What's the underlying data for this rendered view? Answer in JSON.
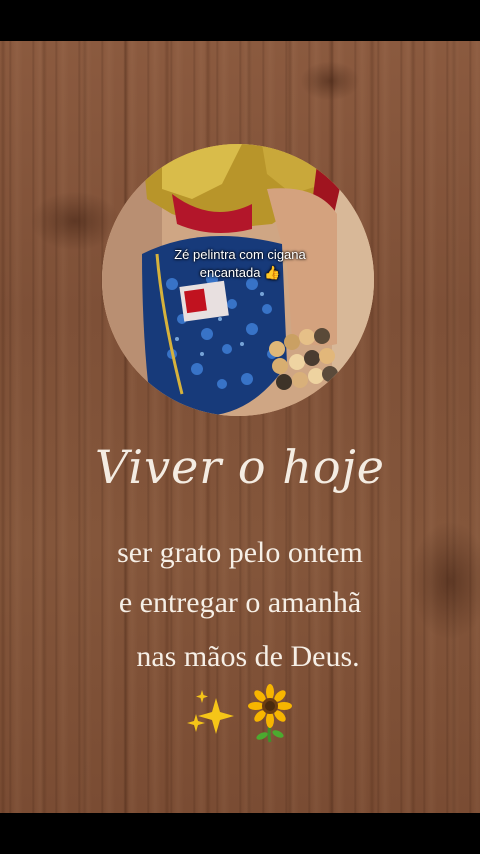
{
  "photo": {
    "caption": "Zé pelintra com cigana encantada 👍"
  },
  "quote": {
    "title": "Viver o hoje",
    "line1": "ser grato pelo ontem",
    "line2": "e entregar o amanhã",
    "line3": "nas mãos de Deus."
  },
  "decorations": {
    "sparkles": "sparkles-icon",
    "sunflower": "sunflower-icon"
  },
  "colors": {
    "wood": "#82543a",
    "text": "#f4ece2",
    "bars": "#000000"
  }
}
